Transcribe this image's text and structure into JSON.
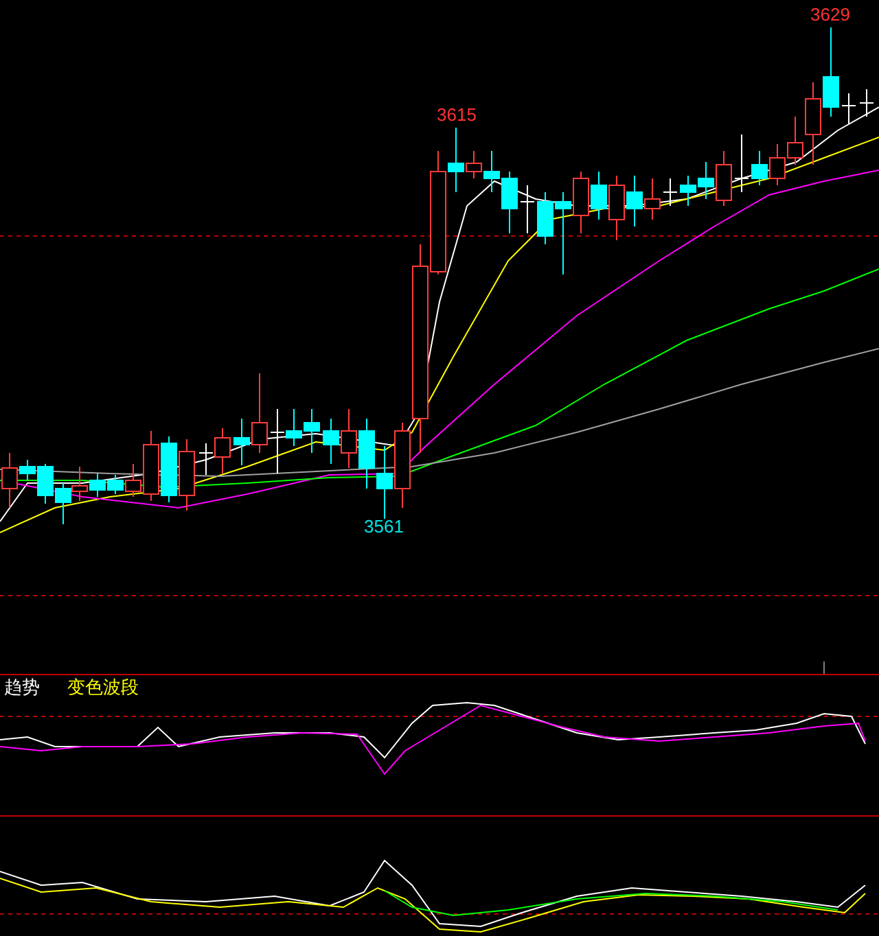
{
  "price_chart": {
    "annotations": [
      {
        "text": "3629",
        "kind": "high"
      },
      {
        "text": "3615",
        "kind": "high"
      },
      {
        "text": "3561",
        "kind": "low"
      }
    ]
  },
  "indicator": {
    "labels": [
      {
        "text": "趋势",
        "color": "#ffffff"
      },
      {
        "text": "变色波段",
        "color": "#ffff00"
      }
    ]
  }
}
